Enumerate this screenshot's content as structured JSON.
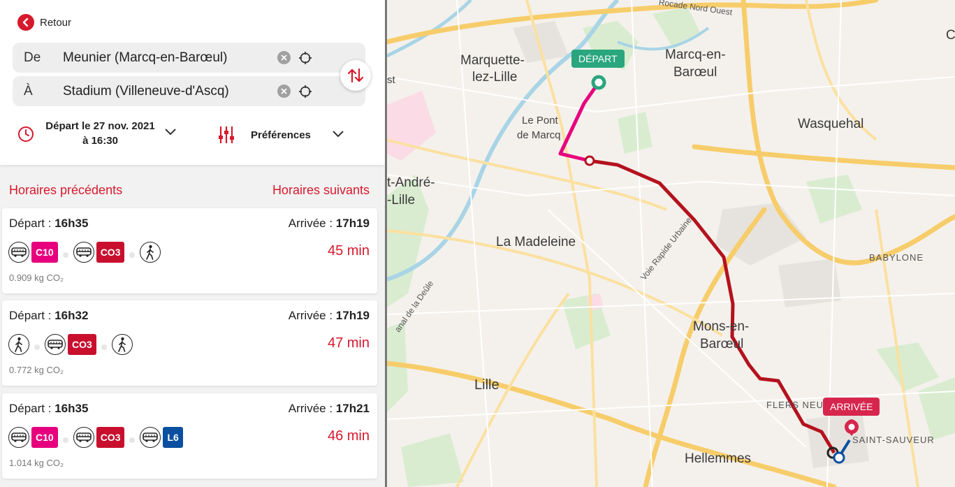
{
  "nav": {
    "back_label": "Retour"
  },
  "search": {
    "from_label": "De",
    "from_value": "Meunier (Marcq-en-Barœul)",
    "to_label": "À",
    "to_value": "Stadium (Villeneuve-d'Ascq)"
  },
  "time": {
    "line1": "Départ le 27 nov. 2021",
    "line2": "à 16:30"
  },
  "prefs": {
    "label": "Préférences"
  },
  "schedules": {
    "prev_label": "Horaires précédents",
    "next_label": "Horaires suivants"
  },
  "colors": {
    "accent": "#d7192c",
    "C10": "#e6007e",
    "CO3": "#c8102e",
    "L6": "#0b4fa0",
    "depart": "#2aa67e",
    "arrivee": "#d7264d"
  },
  "journeys": [
    {
      "dep_label": "Départ : ",
      "dep_time": "16h35",
      "arr_label": "Arrivée : ",
      "arr_time": "17h19",
      "duration": "45 min",
      "co2": "0.909 kg CO₂",
      "legs": [
        "bus-icon",
        "C10",
        "bus-icon",
        "CO3",
        "walk-icon"
      ]
    },
    {
      "dep_label": "Départ : ",
      "dep_time": "16h32",
      "arr_label": "Arrivée : ",
      "arr_time": "17h19",
      "duration": "47 min",
      "co2": "0.772 kg CO₂",
      "legs": [
        "walk-icon",
        "bus-icon",
        "CO3",
        "walk-icon"
      ]
    },
    {
      "dep_label": "Départ : ",
      "dep_time": "16h35",
      "arr_label": "Arrivée : ",
      "arr_time": "17h21",
      "duration": "46 min",
      "co2": "1.014 kg CO₂",
      "legs": [
        "bus-icon",
        "C10",
        "bus-icon",
        "CO3",
        "bus-icon",
        "L6"
      ]
    }
  ],
  "map": {
    "depart_tag": "DÉPART",
    "arrivee_tag": "ARRIVÉE",
    "places": {
      "marquette_1": "Marquette-",
      "marquette_2": "lez-Lille",
      "marcq_1": "Marcq-en-",
      "marcq_2": "Barœul",
      "pont_1": "Le Pont",
      "pont_2": "de Marcq",
      "wasquehal": "Wasquehal",
      "standre_1": "t-André-",
      "standre_2": "-Lille",
      "madeleine": "La Madeleine",
      "babylone": "BABYLONE",
      "mons_1": "Mons-en-",
      "mons_2": "Barœul",
      "lille": "Lille",
      "flers": "FLERS NEU",
      "saint_sauveur": "SAINT-SAUVEUR",
      "hellemmes": "Hellemmes",
      "corner_c": "C",
      "corner_e": "st"
    },
    "roads": {
      "vru": "Voie Rapide Urbaine",
      "canal": "anal de la Deûle",
      "rocade": "Rocade Nord Ouest"
    }
  }
}
